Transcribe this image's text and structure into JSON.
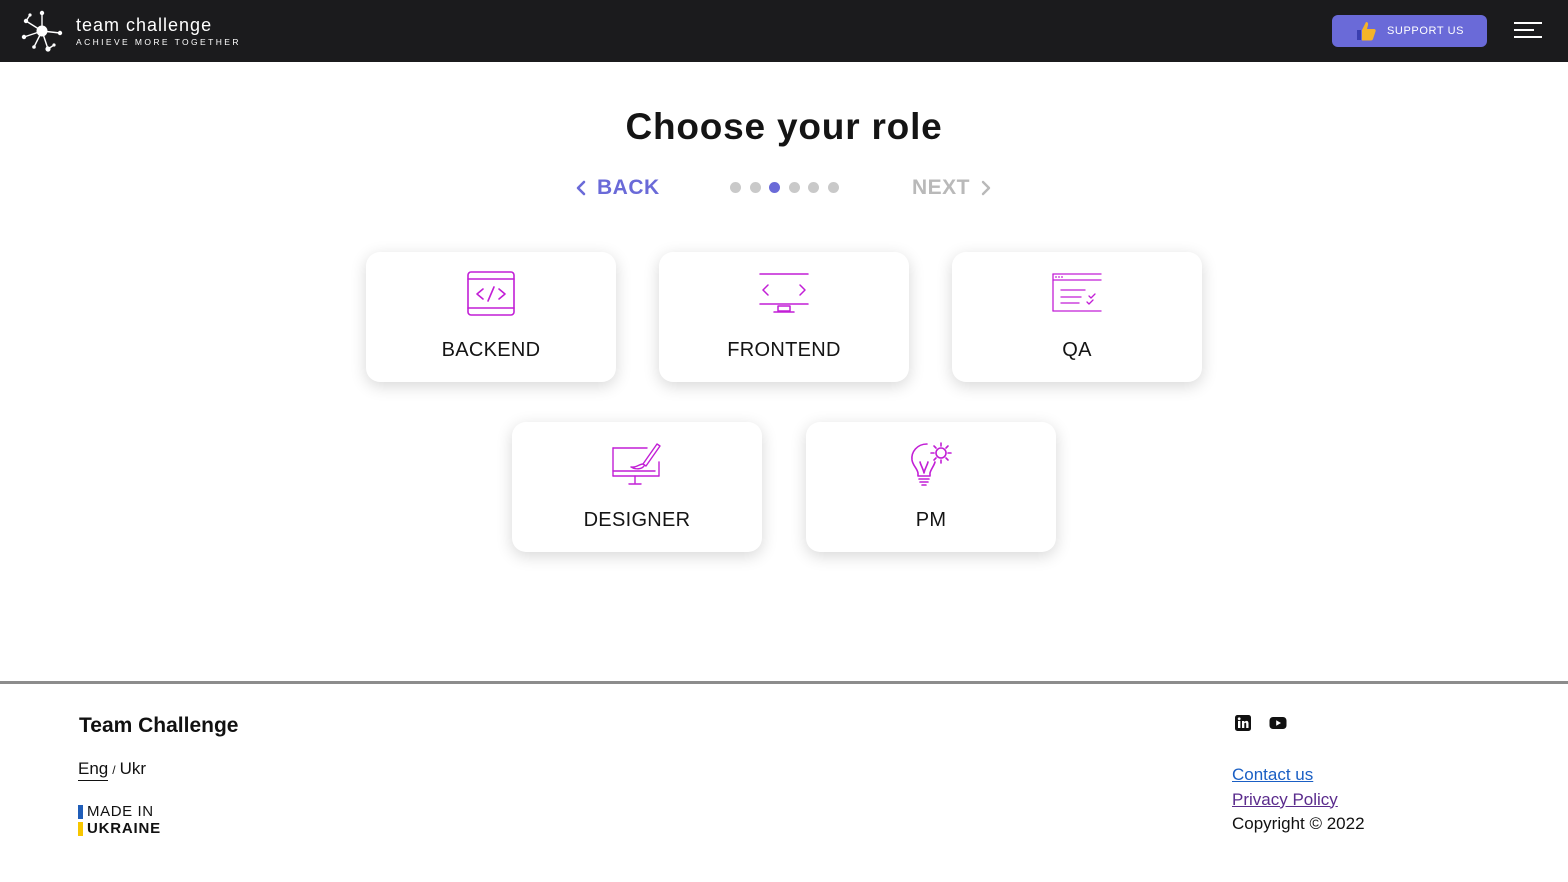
{
  "header": {
    "brand_name": "team challenge",
    "brand_tagline": "ACHIEVE MORE TOGETHER",
    "support_label": "SUPPORT US",
    "logo_icon": "network-logo-icon",
    "menu_icon": "hamburger-menu-icon"
  },
  "main": {
    "title": "Choose your role",
    "back_label": "BACK",
    "next_label": "NEXT",
    "steps_total": 6,
    "steps_active": 3,
    "roles": [
      {
        "label": "BACKEND",
        "icon": "code-window-icon"
      },
      {
        "label": "FRONTEND",
        "icon": "monitor-code-icon"
      },
      {
        "label": "QA",
        "icon": "checklist-window-icon"
      },
      {
        "label": "DESIGNER",
        "icon": "design-monitor-icon"
      },
      {
        "label": "PM",
        "icon": "lightbulb-gear-icon"
      }
    ]
  },
  "footer": {
    "title": "Team Challenge",
    "lang_eng": "Eng",
    "lang_sep": "/",
    "lang_ukr": "Ukr",
    "made_in": "MADE IN",
    "ukraine": "UKRAINE",
    "social": [
      "linkedin-icon",
      "youtube-icon"
    ],
    "contact_label": "Contact us",
    "privacy_label": "Privacy Policy",
    "copyright": "Copyright © 2022"
  },
  "colors": {
    "accent": "#6a6ad8",
    "icon": "#c21fd6",
    "topbar": "#1b1b1d",
    "inactive": "#b9b9b9",
    "ukraine_blue": "#1f5db8",
    "ukraine_yellow": "#f7c600"
  }
}
